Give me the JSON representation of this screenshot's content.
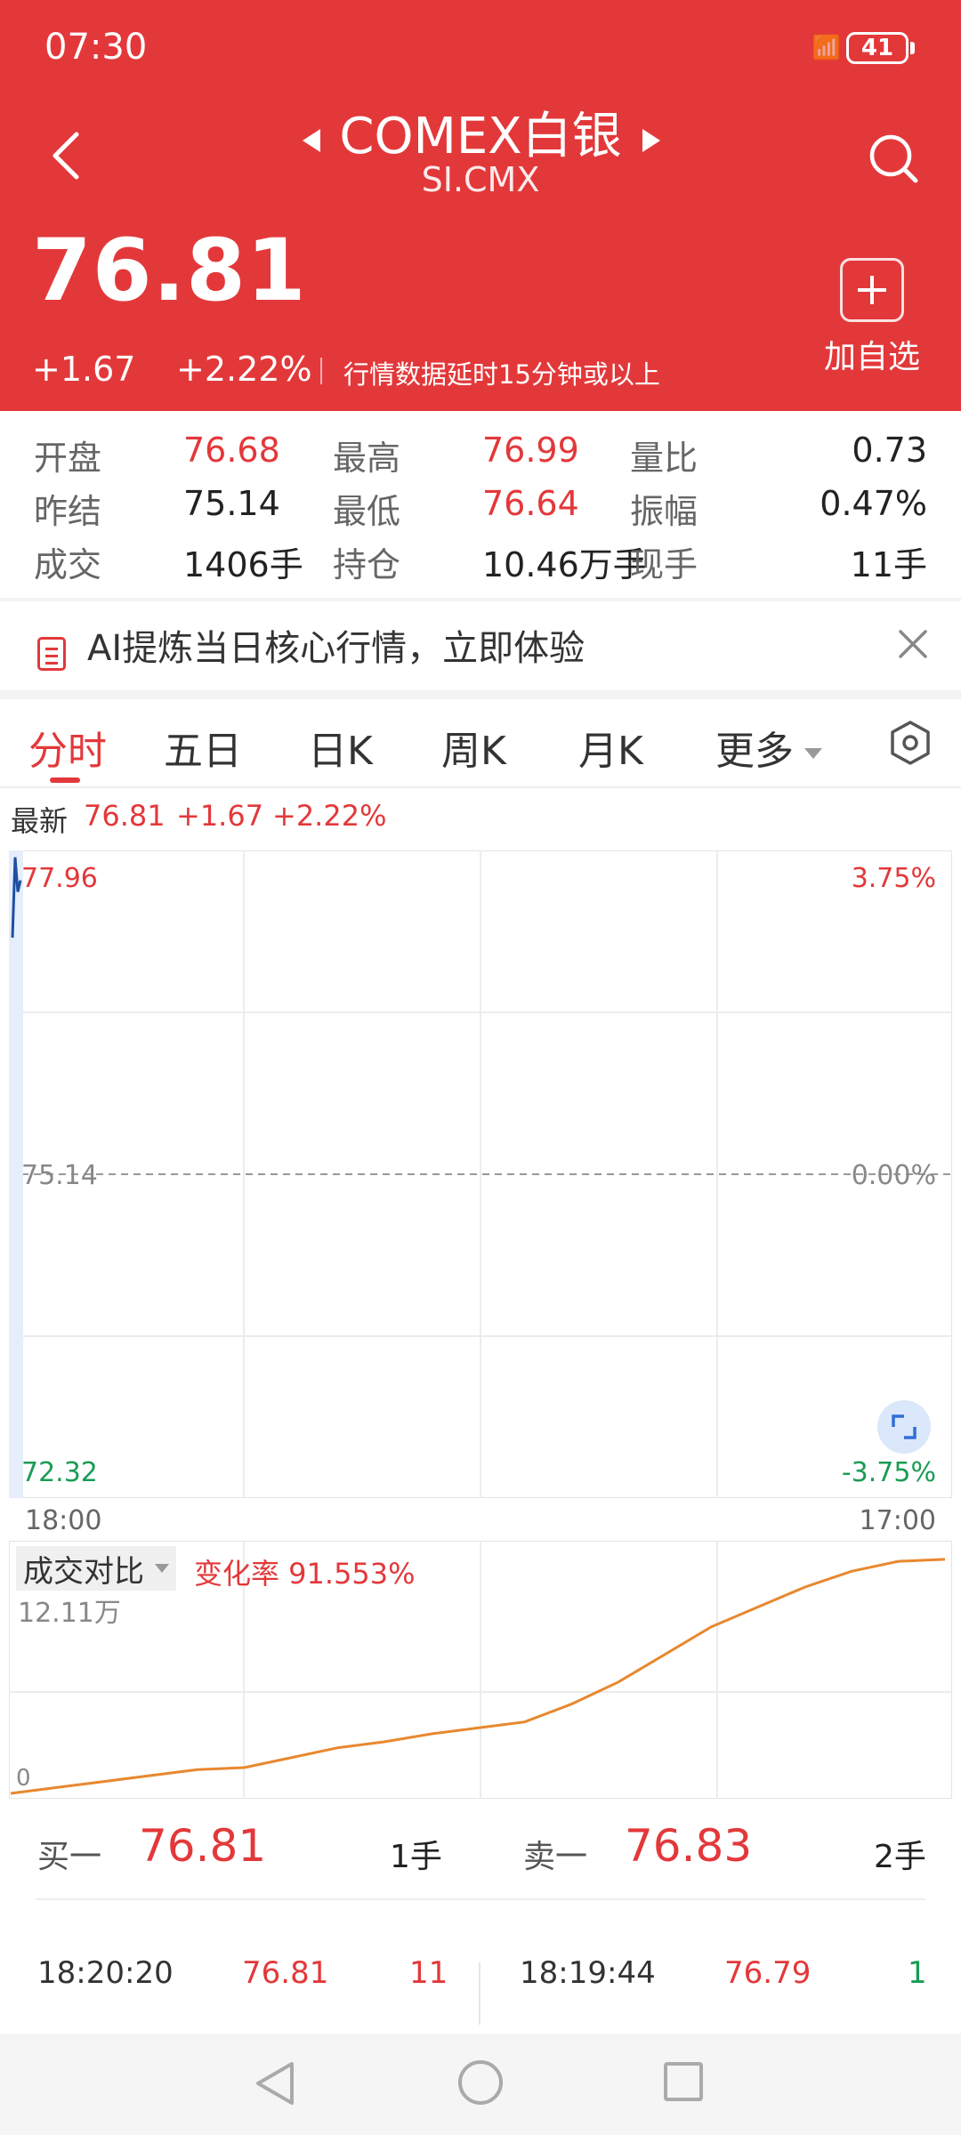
{
  "status_bar": {
    "time": "07:30",
    "signal": "📶",
    "battery": "41"
  },
  "header": {
    "title": "COMEX白银",
    "subtitle": "SI.CMX",
    "price": "76.81",
    "change_abs": "+1.67",
    "change_pct": "+2.22%",
    "delay_note": "行情数据延时15分钟或以上",
    "add_label": "加自选"
  },
  "stats": [
    [
      {
        "label": "开盘",
        "value": "76.68"
      },
      {
        "label": "最高",
        "value": "76.99"
      },
      {
        "label": "量比",
        "value": "0.73"
      }
    ],
    [
      {
        "label": "昨结",
        "value": "75.14"
      },
      {
        "label": "最低",
        "value": "76.64"
      },
      {
        "label": "振幅",
        "value": "0.47%"
      }
    ],
    [
      {
        "label": "成交",
        "value": "1406手"
      },
      {
        "label": "持仓",
        "value": "10.46万手"
      },
      {
        "label": "现手",
        "value": "11手"
      }
    ]
  ],
  "ai_banner": {
    "text": "AI提炼当日核心行情，立即体验"
  },
  "tabs": [
    {
      "label": "分时"
    },
    {
      "label": "五日"
    },
    {
      "label": "日K"
    },
    {
      "label": "周K"
    },
    {
      "label": "月K"
    },
    {
      "label": "更多"
    }
  ],
  "latest": {
    "label": "最新",
    "price": "76.81",
    "change_abs": "+1.67",
    "change_pct": "+2.22%"
  },
  "price_chart": {
    "max_price": "77.96",
    "max_pct": "3.75%",
    "ref_price": "75.14",
    "ref_pct": "0.00%",
    "min_price": "72.32",
    "min_pct": "-3.75%",
    "time_start": "18:00",
    "time_end": "17:00"
  },
  "volume_chart": {
    "dropdown_label": "成交对比",
    "rate_label": "变化率 91.553%",
    "max_label": "12.11万",
    "zero_label": "0"
  },
  "chart_data": [
    {
      "type": "line",
      "title": "",
      "y": [
        77.2,
        77.9,
        77.6,
        77.7
      ],
      "ylim": [
        72.32,
        77.96
      ],
      "xlabel": "",
      "ylabel": "",
      "x_ticks": [
        "18:00",
        "17:00"
      ],
      "reference_line": 75.14
    },
    {
      "type": "line",
      "title": "",
      "x": [
        0,
        0.05,
        0.1,
        0.15,
        0.2,
        0.25,
        0.3,
        0.35,
        0.4,
        0.45,
        0.5,
        0.55,
        0.6,
        0.65,
        0.7,
        0.75,
        0.8,
        0.85,
        0.9,
        0.95,
        1.0
      ],
      "y": [
        0,
        0.3,
        0.6,
        0.9,
        1.2,
        1.3,
        1.8,
        2.3,
        2.6,
        3.0,
        3.3,
        3.6,
        4.5,
        5.6,
        7.0,
        8.4,
        9.4,
        10.4,
        11.2,
        11.7,
        11.8
      ],
      "ylim": [
        0,
        12.11
      ],
      "xlabel": "",
      "ylabel": ""
    }
  ],
  "order_book": {
    "buy_label": "买一",
    "buy_price": "76.81",
    "buy_qty": "1手",
    "sell_label": "卖一",
    "sell_price": "76.83",
    "sell_qty": "2手"
  },
  "trades": [
    {
      "time": "18:20:20",
      "price": "76.81",
      "qty": "11"
    },
    {
      "time": "18:19:44",
      "price": "76.79",
      "qty": "1"
    }
  ],
  "colors": {
    "accent": "#e3383a",
    "down": "#1a9c56",
    "price_line": "#1e4fa3",
    "volume_line": "#e8882f"
  }
}
